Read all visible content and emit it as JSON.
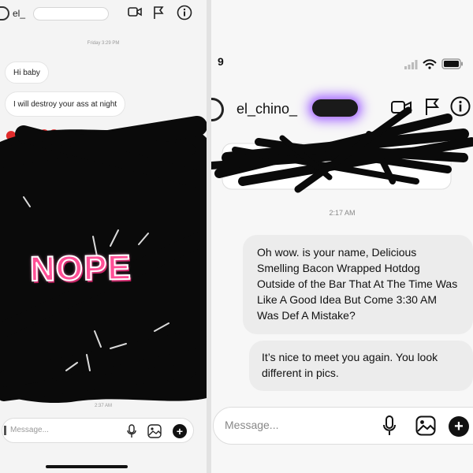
{
  "left": {
    "header": {
      "username": "el_"
    },
    "date_label": "Friday 3:29 PM",
    "messages": [
      "Hi baby",
      "I will destroy your ass at night"
    ],
    "hearts": [
      "❤",
      "❤"
    ],
    "overlay_text": "NOPE",
    "time_label": "2:37 AM",
    "composer": {
      "placeholder": "Message..."
    }
  },
  "right": {
    "status": {
      "time": "9"
    },
    "header": {
      "username": "el_chino_"
    },
    "date_label": "2:17 AM",
    "messages": [
      "Oh wow. is your name, Delicious Smelling Bacon Wrapped Hotdog Outside of the Bar That At The Time Was Like A Good Idea But Come 3:30 AM Was Def A Mistake?",
      "It’s nice to meet you again.  You look different in pics."
    ],
    "composer": {
      "placeholder": "Message..."
    }
  },
  "icons": {
    "left_header": [
      "video-icon",
      "flag-icon",
      "info-icon"
    ],
    "left_composer": [
      "camera-icon",
      "microphone-icon",
      "image-icon",
      "plus-icon"
    ],
    "right_status": [
      "signal-icon",
      "wifi-icon",
      "battery-icon"
    ],
    "right_header": [
      "video-icon",
      "flag-icon",
      "info-icon"
    ],
    "right_composer": [
      "microphone-icon",
      "image-icon",
      "plus-icon"
    ]
  },
  "colors": {
    "bubble_received": "#ececec",
    "overlay_text": "#ff4f96",
    "heart": "#e02b2b",
    "redaction_glow": "#b07cff"
  }
}
